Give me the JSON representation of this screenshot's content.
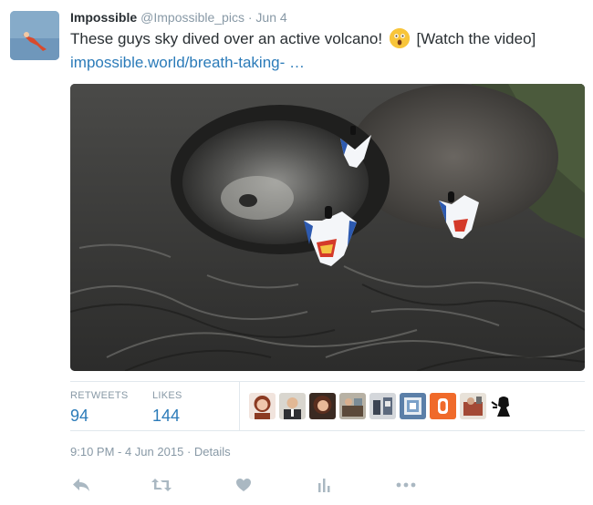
{
  "tweet": {
    "author_name": "Impossible",
    "author_handle": "@Impossible_pics",
    "separator": "·",
    "date": "Jun 4",
    "text_before_emoji": "These guys sky dived over an active volcano!",
    "text_after_emoji": "[Watch the video]",
    "link_text": "impossible.world/breath-taking- …",
    "emoji_icon": "astonished-face-emoji"
  },
  "stats": {
    "retweets_label": "RETWEETS",
    "retweets_count": "94",
    "likes_label": "LIKES",
    "likes_count": "144"
  },
  "timestamp": {
    "text": "9:10 PM - 4 Jun 2015",
    "separator": "·",
    "details_label": "Details"
  },
  "actions": [
    {
      "name": "reply",
      "icon": "reply-icon"
    },
    {
      "name": "retweet",
      "icon": "retweet-icon"
    },
    {
      "name": "like",
      "icon": "heart-icon"
    },
    {
      "name": "analytics",
      "icon": "analytics-icon"
    },
    {
      "name": "more",
      "icon": "more-icon"
    }
  ],
  "colors": {
    "link": "#2b7bb9",
    "muted": "#8899a6",
    "text": "#292f33",
    "action_icon": "#aab8c2",
    "divider": "#e1e8ed"
  }
}
